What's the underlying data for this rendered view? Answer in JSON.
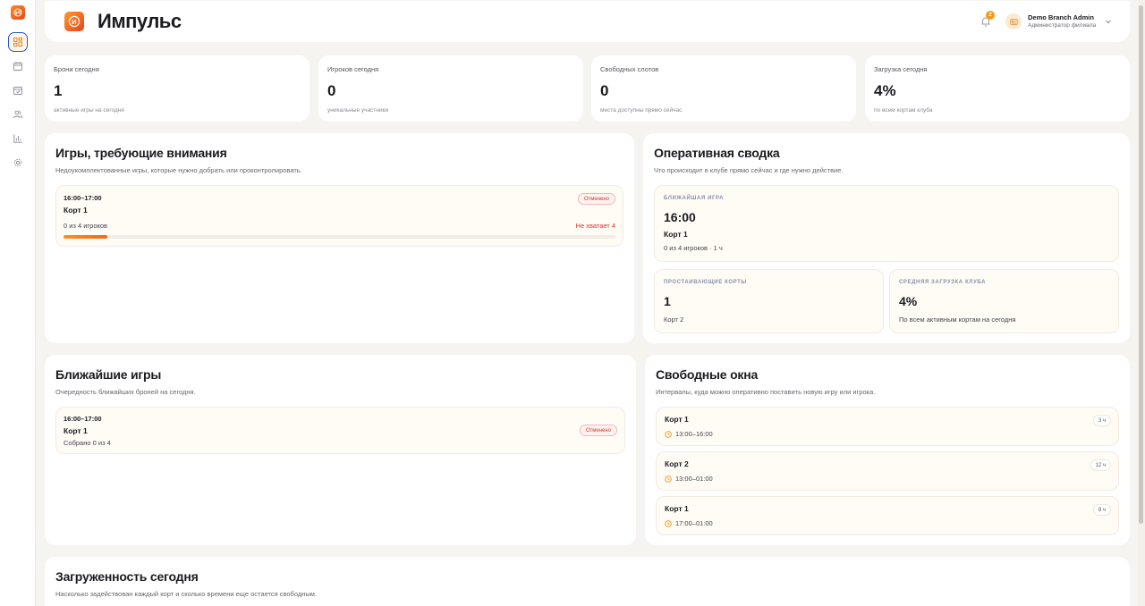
{
  "brand": {
    "logo_letter": "И",
    "title": "Импульс"
  },
  "header": {
    "notifications_count": "2",
    "user_name": "Demo Branch Admin",
    "user_role": "Администратор филиала"
  },
  "stats": [
    {
      "label": "Брони сегодня",
      "value": "1",
      "sub": "активные игры на сегодня"
    },
    {
      "label": "Игроков сегодня",
      "value": "0",
      "sub": "уникальные участники"
    },
    {
      "label": "Свободных слотов",
      "value": "0",
      "sub": "места доступны прямо сейчас"
    },
    {
      "label": "Загрузка сегодня",
      "value": "4%",
      "sub": "по всем кортам клуба"
    }
  ],
  "attention": {
    "title": "Игры, требующие внимания",
    "subtitle": "Недоукомплектованные игры, которые нужно добрать или проконтролировать.",
    "game": {
      "time": "16:00–17:00",
      "court": "Корт 1",
      "status": "Отменено",
      "players": "0 из 4 игроков",
      "missing": "Не хватает 4",
      "progress": 0.08
    }
  },
  "summary": {
    "title": "Оперативная сводка",
    "subtitle": "Что происходит в клубе прямо сейчас и где нужно действие.",
    "next_game": {
      "eyebrow": "БЛИЖАЙШАЯ ИГРА",
      "time": "16:00",
      "court": "Корт 1",
      "meta": "0 из 4 игроков · 1 ч"
    },
    "idle": {
      "eyebrow": "ПРОСТАИВАЮЩИЕ КОРТЫ",
      "value": "1",
      "sub": "Корт 2"
    },
    "avg_load": {
      "eyebrow": "СРЕДНЯЯ ЗАГРУЗКА КЛУБА",
      "value": "4%",
      "sub": "По всем активным кортам на сегодня"
    }
  },
  "upcoming": {
    "title": "Ближайшие игры",
    "subtitle": "Очередность ближайших броней на сегодня.",
    "game": {
      "time": "16:00–17:00",
      "court": "Корт 1",
      "collected": "Собрано 0 из 4",
      "status": "Отменено"
    }
  },
  "free_windows": {
    "title": "Свободные окна",
    "subtitle": "Интервалы, куда можно оперативно поставить новую игру или игрока.",
    "slots": [
      {
        "court": "Корт 1",
        "range": "13:00–16:00",
        "hours": "3 ч"
      },
      {
        "court": "Корт 2",
        "range": "13:00–01:00",
        "hours": "12 ч"
      },
      {
        "court": "Корт 1",
        "range": "17:00–01:00",
        "hours": "8 ч"
      }
    ]
  },
  "load": {
    "title": "Загруженность сегодня",
    "subtitle": "Насколько задействован каждый корт и сколько времени еще остается свободным."
  },
  "colors": {
    "accent": "#f26b13",
    "danger": "#d8342b",
    "nav_active": "#2d55c8"
  }
}
